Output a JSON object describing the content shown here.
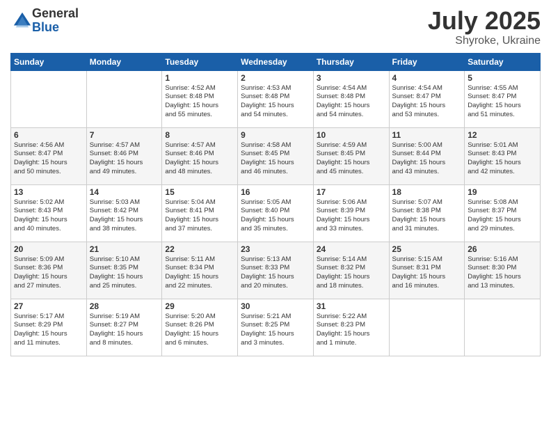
{
  "logo": {
    "general": "General",
    "blue": "Blue"
  },
  "title": {
    "month": "July 2025",
    "location": "Shyroke, Ukraine"
  },
  "weekdays": [
    "Sunday",
    "Monday",
    "Tuesday",
    "Wednesday",
    "Thursday",
    "Friday",
    "Saturday"
  ],
  "weeks": [
    [
      {
        "day": "",
        "info": ""
      },
      {
        "day": "",
        "info": ""
      },
      {
        "day": "1",
        "info": "Sunrise: 4:52 AM\nSunset: 8:48 PM\nDaylight: 15 hours\nand 55 minutes."
      },
      {
        "day": "2",
        "info": "Sunrise: 4:53 AM\nSunset: 8:48 PM\nDaylight: 15 hours\nand 54 minutes."
      },
      {
        "day": "3",
        "info": "Sunrise: 4:54 AM\nSunset: 8:48 PM\nDaylight: 15 hours\nand 54 minutes."
      },
      {
        "day": "4",
        "info": "Sunrise: 4:54 AM\nSunset: 8:47 PM\nDaylight: 15 hours\nand 53 minutes."
      },
      {
        "day": "5",
        "info": "Sunrise: 4:55 AM\nSunset: 8:47 PM\nDaylight: 15 hours\nand 51 minutes."
      }
    ],
    [
      {
        "day": "6",
        "info": "Sunrise: 4:56 AM\nSunset: 8:47 PM\nDaylight: 15 hours\nand 50 minutes."
      },
      {
        "day": "7",
        "info": "Sunrise: 4:57 AM\nSunset: 8:46 PM\nDaylight: 15 hours\nand 49 minutes."
      },
      {
        "day": "8",
        "info": "Sunrise: 4:57 AM\nSunset: 8:46 PM\nDaylight: 15 hours\nand 48 minutes."
      },
      {
        "day": "9",
        "info": "Sunrise: 4:58 AM\nSunset: 8:45 PM\nDaylight: 15 hours\nand 46 minutes."
      },
      {
        "day": "10",
        "info": "Sunrise: 4:59 AM\nSunset: 8:45 PM\nDaylight: 15 hours\nand 45 minutes."
      },
      {
        "day": "11",
        "info": "Sunrise: 5:00 AM\nSunset: 8:44 PM\nDaylight: 15 hours\nand 43 minutes."
      },
      {
        "day": "12",
        "info": "Sunrise: 5:01 AM\nSunset: 8:43 PM\nDaylight: 15 hours\nand 42 minutes."
      }
    ],
    [
      {
        "day": "13",
        "info": "Sunrise: 5:02 AM\nSunset: 8:43 PM\nDaylight: 15 hours\nand 40 minutes."
      },
      {
        "day": "14",
        "info": "Sunrise: 5:03 AM\nSunset: 8:42 PM\nDaylight: 15 hours\nand 38 minutes."
      },
      {
        "day": "15",
        "info": "Sunrise: 5:04 AM\nSunset: 8:41 PM\nDaylight: 15 hours\nand 37 minutes."
      },
      {
        "day": "16",
        "info": "Sunrise: 5:05 AM\nSunset: 8:40 PM\nDaylight: 15 hours\nand 35 minutes."
      },
      {
        "day": "17",
        "info": "Sunrise: 5:06 AM\nSunset: 8:39 PM\nDaylight: 15 hours\nand 33 minutes."
      },
      {
        "day": "18",
        "info": "Sunrise: 5:07 AM\nSunset: 8:38 PM\nDaylight: 15 hours\nand 31 minutes."
      },
      {
        "day": "19",
        "info": "Sunrise: 5:08 AM\nSunset: 8:37 PM\nDaylight: 15 hours\nand 29 minutes."
      }
    ],
    [
      {
        "day": "20",
        "info": "Sunrise: 5:09 AM\nSunset: 8:36 PM\nDaylight: 15 hours\nand 27 minutes."
      },
      {
        "day": "21",
        "info": "Sunrise: 5:10 AM\nSunset: 8:35 PM\nDaylight: 15 hours\nand 25 minutes."
      },
      {
        "day": "22",
        "info": "Sunrise: 5:11 AM\nSunset: 8:34 PM\nDaylight: 15 hours\nand 22 minutes."
      },
      {
        "day": "23",
        "info": "Sunrise: 5:13 AM\nSunset: 8:33 PM\nDaylight: 15 hours\nand 20 minutes."
      },
      {
        "day": "24",
        "info": "Sunrise: 5:14 AM\nSunset: 8:32 PM\nDaylight: 15 hours\nand 18 minutes."
      },
      {
        "day": "25",
        "info": "Sunrise: 5:15 AM\nSunset: 8:31 PM\nDaylight: 15 hours\nand 16 minutes."
      },
      {
        "day": "26",
        "info": "Sunrise: 5:16 AM\nSunset: 8:30 PM\nDaylight: 15 hours\nand 13 minutes."
      }
    ],
    [
      {
        "day": "27",
        "info": "Sunrise: 5:17 AM\nSunset: 8:29 PM\nDaylight: 15 hours\nand 11 minutes."
      },
      {
        "day": "28",
        "info": "Sunrise: 5:19 AM\nSunset: 8:27 PM\nDaylight: 15 hours\nand 8 minutes."
      },
      {
        "day": "29",
        "info": "Sunrise: 5:20 AM\nSunset: 8:26 PM\nDaylight: 15 hours\nand 6 minutes."
      },
      {
        "day": "30",
        "info": "Sunrise: 5:21 AM\nSunset: 8:25 PM\nDaylight: 15 hours\nand 3 minutes."
      },
      {
        "day": "31",
        "info": "Sunrise: 5:22 AM\nSunset: 8:23 PM\nDaylight: 15 hours\nand 1 minute."
      },
      {
        "day": "",
        "info": ""
      },
      {
        "day": "",
        "info": ""
      }
    ]
  ]
}
